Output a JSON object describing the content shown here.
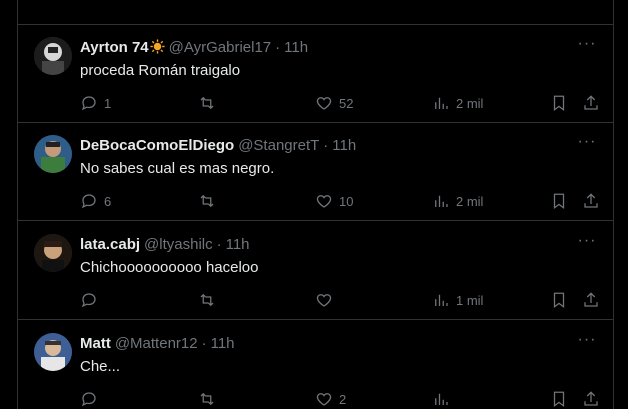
{
  "tweets": [
    {
      "name": "Ayrton 74",
      "handle": "@AyrGabriel17",
      "time": "11h",
      "text": "proceda Román traigalo",
      "replies": "1",
      "retweets": "",
      "likes": "52",
      "views": "2 mil",
      "avatar_colors": [
        "#c8c8c8",
        "#3a3a3a"
      ]
    },
    {
      "name": "DeBocaComoElDiego",
      "handle": "@StangretT",
      "time": "11h",
      "text": "No sabes cual es mas negro.",
      "replies": "6",
      "retweets": "",
      "likes": "10",
      "views": "2 mil",
      "avatar_colors": [
        "#3a7bd5",
        "#2d6b3a"
      ]
    },
    {
      "name": "lata.cabj",
      "handle": "@ltyashilc",
      "time": "11h",
      "text": "Chichoooooooooo haceloo",
      "replies": "",
      "retweets": "",
      "likes": "",
      "views": "1 mil",
      "avatar_colors": [
        "#c9a27c",
        "#2a1c14"
      ]
    },
    {
      "name": "Matt",
      "handle": "@Mattenr12",
      "time": "11h",
      "text": "Che...",
      "replies": "",
      "retweets": "",
      "likes": "2",
      "views": "",
      "avatar_colors": [
        "#4a6fa5",
        "#dddddd"
      ]
    }
  ],
  "separator": "·",
  "more_label": "···",
  "emoji_name": "sun-emoji"
}
